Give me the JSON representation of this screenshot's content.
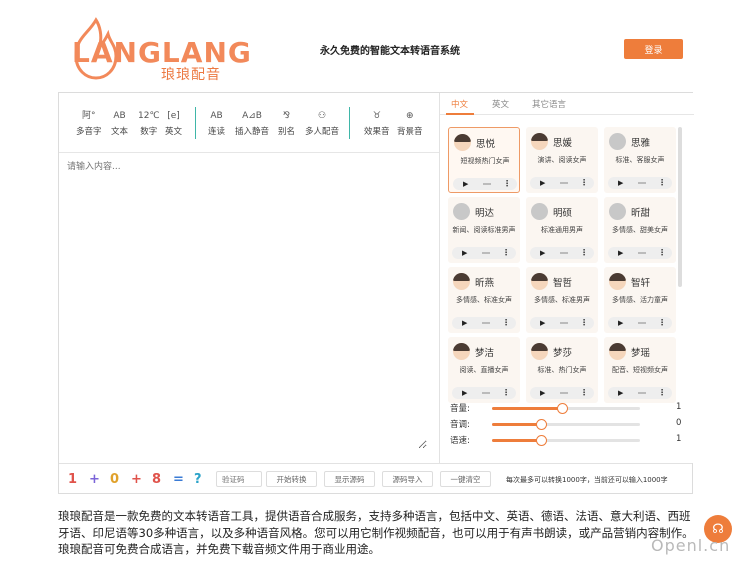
{
  "brand": {
    "logo_word": "LANGLANG",
    "logo_sub": "琅琅配音",
    "accent": "#ee7d3b"
  },
  "header": {
    "title": "永久免费的智能文本转语音系统",
    "login": "登录"
  },
  "toolbar": [
    {
      "icon": "阿°",
      "label": "多音字",
      "name": "polyphone"
    },
    {
      "icon": "AB",
      "label": "文本",
      "name": "text"
    },
    {
      "icon": "12℃",
      "label": "数字",
      "name": "number"
    },
    {
      "icon": "[e]",
      "label": "英文",
      "name": "english"
    },
    {
      "icon": "AB",
      "label": "连读",
      "name": "liaison"
    },
    {
      "icon": "A⊿B",
      "label": "插入静音",
      "name": "insert-silence"
    },
    {
      "icon": "⅋",
      "label": "别名",
      "name": "alias"
    },
    {
      "icon": "⚇",
      "label": "多人配音",
      "name": "multi-voice"
    },
    {
      "icon": "♉",
      "label": "效果音",
      "name": "sound-effect"
    },
    {
      "icon": "⊕",
      "label": "背景音",
      "name": "background-sound"
    }
  ],
  "editor": {
    "placeholder": "请输入内容..."
  },
  "tabs": [
    "中文",
    "英文",
    "其它语言"
  ],
  "voices": [
    {
      "name": "思悦",
      "desc": "短视频热门女声",
      "avatar": "face",
      "selected": true
    },
    {
      "name": "思媛",
      "desc": "演讲、阅读女声",
      "avatar": "face"
    },
    {
      "name": "思雅",
      "desc": "标准、客服女声",
      "avatar": "gray"
    },
    {
      "name": "明达",
      "desc": "新闻、阅读标准男声",
      "avatar": "gray"
    },
    {
      "name": "明硕",
      "desc": "标准通用男声",
      "avatar": "gray"
    },
    {
      "name": "昕甜",
      "desc": "多情感、甜美女声",
      "avatar": "gray"
    },
    {
      "name": "昕燕",
      "desc": "多情感、标准女声",
      "avatar": "face"
    },
    {
      "name": "智哲",
      "desc": "多情感、标准男声",
      "avatar": "face"
    },
    {
      "name": "智轩",
      "desc": "多情感、活力童声",
      "avatar": "face"
    },
    {
      "name": "梦洁",
      "desc": "阅读、直播女声",
      "avatar": "face"
    },
    {
      "name": "梦莎",
      "desc": "标准、热门女声",
      "avatar": "face"
    },
    {
      "name": "梦瑶",
      "desc": "配音、短视频女声",
      "avatar": "face"
    }
  ],
  "sliders": [
    {
      "label": "音量:",
      "value": "1",
      "fraction": 0.47
    },
    {
      "label": "音调:",
      "value": "0",
      "fraction": 0.33
    },
    {
      "label": "语速:",
      "value": "1",
      "fraction": 0.33
    }
  ],
  "bottom": {
    "digits": [
      "1",
      "+",
      "0",
      "+",
      "8",
      "=",
      "?"
    ],
    "captcha_placeholder": "验证码",
    "buttons": [
      "开始转换",
      "显示源码",
      "源码导入",
      "一键清空"
    ],
    "note": "每次最多可以转换1000字，当前还可以输入1000字"
  },
  "description": "琅琅配音是一款免费的文本转语音工具，提供语音合成服务，支持多种语言，包括中文、英语、德语、法语、意大利语、西班牙语、印尼语等30多种语言，以及多种语音风格。您可以用它制作视频配音，也可以用于有声书朗读，或产品营销内容制作。琅琅配音可免费合成语言，并免费下载音频文件用于商业用途。",
  "watermark": "Openl.cn"
}
